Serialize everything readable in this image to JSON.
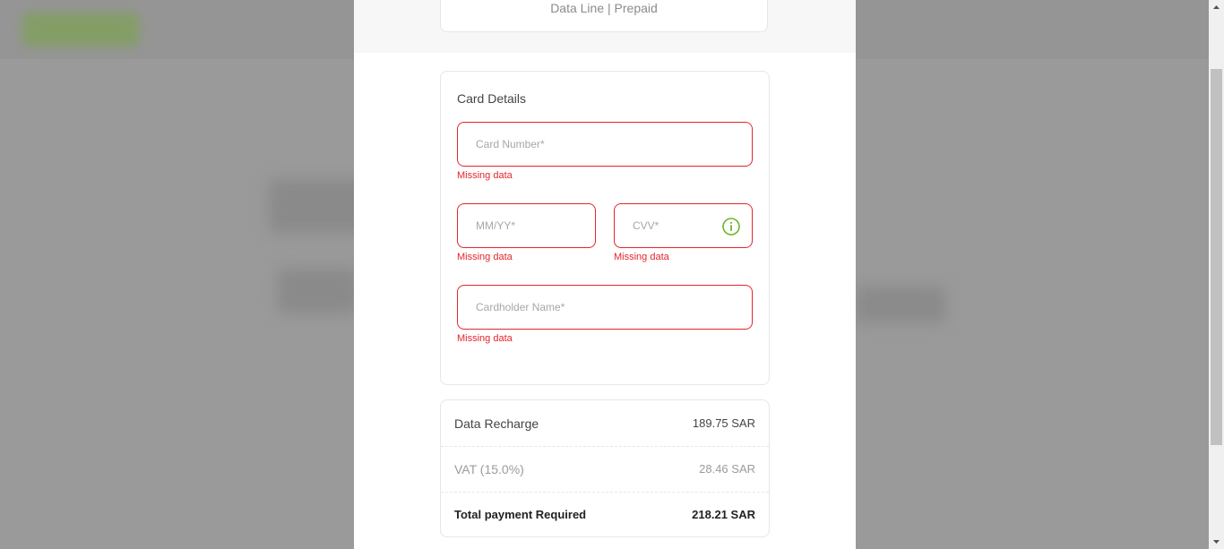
{
  "plan": {
    "subtitle": "Data Line | Prepaid"
  },
  "card_details": {
    "title": "Card Details",
    "card_number": {
      "placeholder": "Card Number*",
      "value": "",
      "error": "Missing data"
    },
    "expiry": {
      "placeholder": "MM/YY*",
      "value": "",
      "error": "Missing data"
    },
    "cvv": {
      "placeholder": "CVV*",
      "value": "",
      "error": "Missing data",
      "icon": "info-icon"
    },
    "cardholder": {
      "placeholder": "Cardholder Name*",
      "value": "",
      "error": "Missing data"
    }
  },
  "summary": {
    "rows": [
      {
        "label": "Data Recharge",
        "value": "189.75 SAR"
      },
      {
        "label": "VAT (15.0%)",
        "value": "28.46 SAR"
      },
      {
        "label": "Total payment Required",
        "value": "218.21 SAR"
      }
    ]
  },
  "colors": {
    "error": "#e4252d",
    "accent": "#6cb52d"
  }
}
